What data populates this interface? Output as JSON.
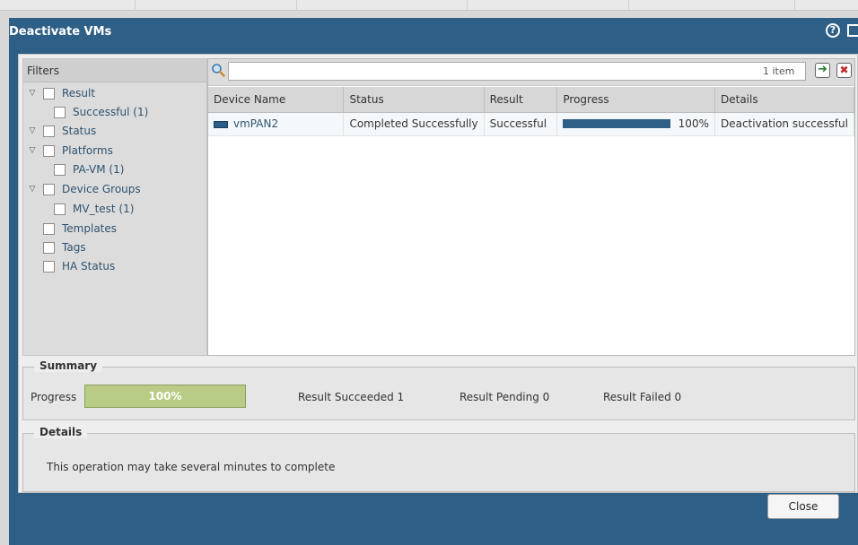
{
  "dialog": {
    "title": "Deactivate VMs",
    "help_icon_glyph": "?"
  },
  "filters": {
    "header": "Filters",
    "items": [
      {
        "label": "Result",
        "expandable": true
      },
      {
        "label": "Successful (1)",
        "expandable": false
      },
      {
        "label": "Status",
        "expandable": true
      },
      {
        "label": "Platforms",
        "expandable": true
      },
      {
        "label": "PA-VM (1)",
        "expandable": false
      },
      {
        "label": "Device Groups",
        "expandable": true
      },
      {
        "label": "MV_test (1)",
        "expandable": false
      },
      {
        "label": "Templates",
        "expandable": false
      },
      {
        "label": "Tags",
        "expandable": false
      },
      {
        "label": "HA Status",
        "expandable": false
      }
    ]
  },
  "search": {
    "value": "",
    "placeholder": "",
    "count": "1 item",
    "apply_glyph": "➜",
    "clear_glyph": "✖"
  },
  "table": {
    "columns": [
      "Device Name",
      "Status",
      "Result",
      "Progress",
      "Details"
    ],
    "rows": [
      {
        "device_name": "vmPAN2",
        "status": "Completed Successfully",
        "result": "Successful",
        "progress": 100,
        "progress_label": "100%",
        "details": "Deactivation successful"
      }
    ]
  },
  "summary": {
    "legend": "Summary",
    "progress_label": "Progress",
    "progress": 100,
    "progress_text": "100%",
    "succeeded": "Result Succeeded  1",
    "pending": "Result Pending  0",
    "failed": "Result Failed  0"
  },
  "details": {
    "legend": "Details",
    "message": "This operation may take several minutes to complete"
  },
  "footer": {
    "close_label": "Close"
  },
  "colors": {
    "title_bar": "#2e5f86",
    "progress_fill": "#2e5f86",
    "summary_fill": "#b9cc85"
  },
  "icons": {
    "help": "help-icon",
    "maximize": "maximize-icon",
    "search": "search-icon",
    "apply": "apply-filter-icon",
    "clear": "clear-filter-icon",
    "device": "device-icon",
    "expand": "triangle-down-icon"
  }
}
